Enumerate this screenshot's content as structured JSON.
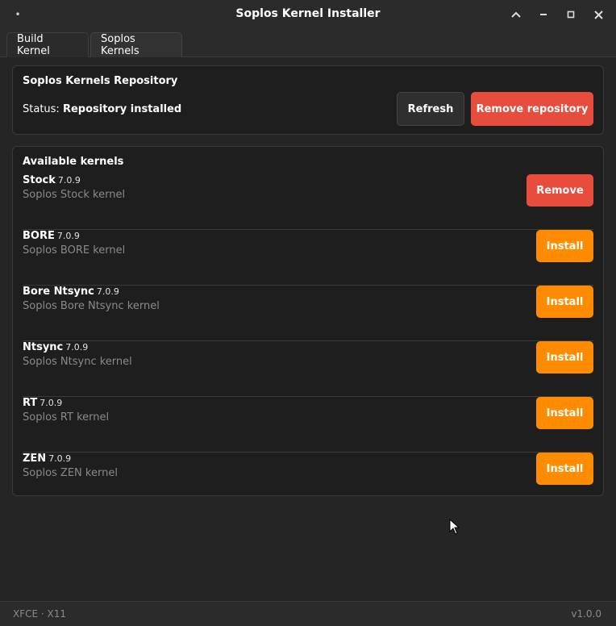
{
  "window": {
    "title": "Soplos Kernel Installer",
    "menu_dot": "•"
  },
  "tabs": [
    {
      "label": "Build Kernel",
      "active": false
    },
    {
      "label": "Soplos Kernels",
      "active": true
    }
  ],
  "repository": {
    "title": "Soplos Kernels Repository",
    "status_label": "Status:",
    "status_value": "Repository installed",
    "refresh_label": "Refresh",
    "remove_repo_label": "Remove repository"
  },
  "kernels": {
    "title": "Available kernels",
    "items": [
      {
        "name": "Stock",
        "version": "7.0.9",
        "description": "Soplos Stock kernel",
        "action": "Remove"
      },
      {
        "name": "BORE",
        "version": "7.0.9",
        "description": "Soplos BORE kernel",
        "action": "Install"
      },
      {
        "name": "Bore Ntsync",
        "version": "7.0.9",
        "description": "Soplos Bore Ntsync kernel",
        "action": "Install"
      },
      {
        "name": "Ntsync",
        "version": "7.0.9",
        "description": "Soplos Ntsync kernel",
        "action": "Install"
      },
      {
        "name": "RT",
        "version": "7.0.9",
        "description": "Soplos RT kernel",
        "action": "Install"
      },
      {
        "name": "ZEN",
        "version": "7.0.9",
        "description": "Soplos ZEN kernel",
        "action": "Install"
      }
    ]
  },
  "footer": {
    "environment": "XFCE · X11",
    "version": "v1.0.0"
  },
  "colors": {
    "accent_orange": "#ff8c00",
    "danger_red": "#e74c3c"
  },
  "icons": {
    "minimize": "chevron-up-icon",
    "maximize": "maximize-icon",
    "close": "close-icon"
  }
}
